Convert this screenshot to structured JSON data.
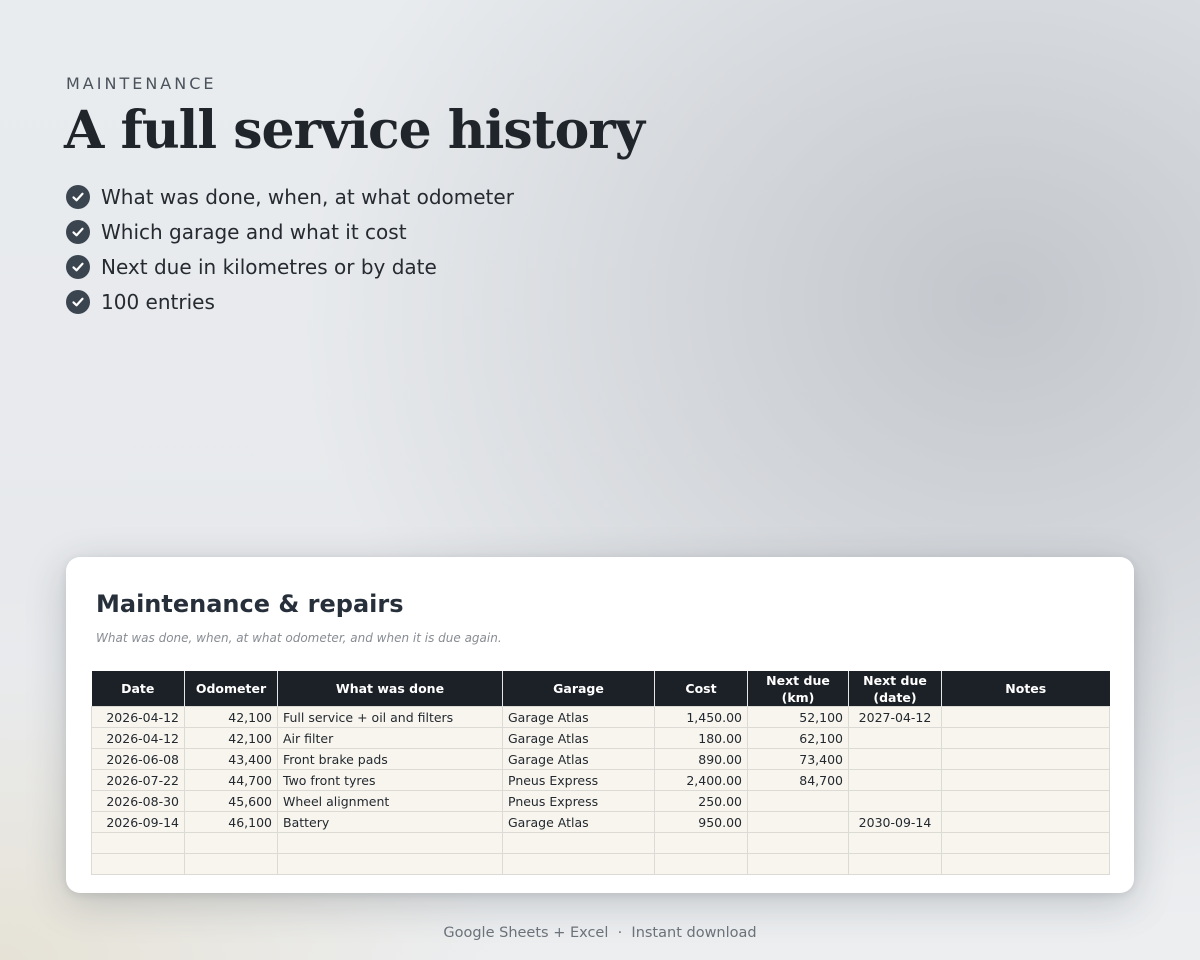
{
  "header": {
    "eyebrow": "MAINTENANCE",
    "title": "A full service history",
    "features": [
      "What was done, when, at what odometer",
      "Which garage and what it cost",
      "Next due in kilometres or by date",
      "100 entries"
    ]
  },
  "sheet": {
    "title": "Maintenance & repairs",
    "subtitle": "What was done, when, at what odometer, and when it is due again.",
    "columns": [
      "Date",
      "Odometer",
      "What was done",
      "Garage",
      "Cost",
      "Next due (km)",
      "Next due\n(date)",
      "Notes"
    ],
    "rows": [
      [
        "2026-04-12",
        "42,100",
        "Full service + oil and filters",
        "Garage Atlas",
        "1,450.00",
        "52,100",
        "2027-04-12",
        ""
      ],
      [
        "2026-04-12",
        "42,100",
        "Air filter",
        "Garage Atlas",
        "180.00",
        "62,100",
        "",
        ""
      ],
      [
        "2026-06-08",
        "43,400",
        "Front brake pads",
        "Garage Atlas",
        "890.00",
        "73,400",
        "",
        ""
      ],
      [
        "2026-07-22",
        "44,700",
        "Two front tyres",
        "Pneus Express",
        "2,400.00",
        "84,700",
        "",
        ""
      ],
      [
        "2026-08-30",
        "45,600",
        "Wheel alignment",
        "Pneus Express",
        "250.00",
        "",
        "",
        ""
      ],
      [
        "2026-09-14",
        "46,100",
        "Battery",
        "Garage Atlas",
        "950.00",
        "",
        "2030-09-14",
        ""
      ],
      [
        "",
        "",
        "",
        "",
        "",
        "",
        "",
        ""
      ],
      [
        "",
        "",
        "",
        "",
        "",
        "",
        "",
        ""
      ]
    ]
  },
  "footer": {
    "text": "Google Sheets + Excel  ·  Instant download"
  },
  "colors": {
    "header_bg": "#1c2127",
    "cell_bg": "#f8f5ef",
    "check_bg": "#3b4550"
  },
  "icons": {
    "feature_bullet": "check-circle-icon"
  }
}
